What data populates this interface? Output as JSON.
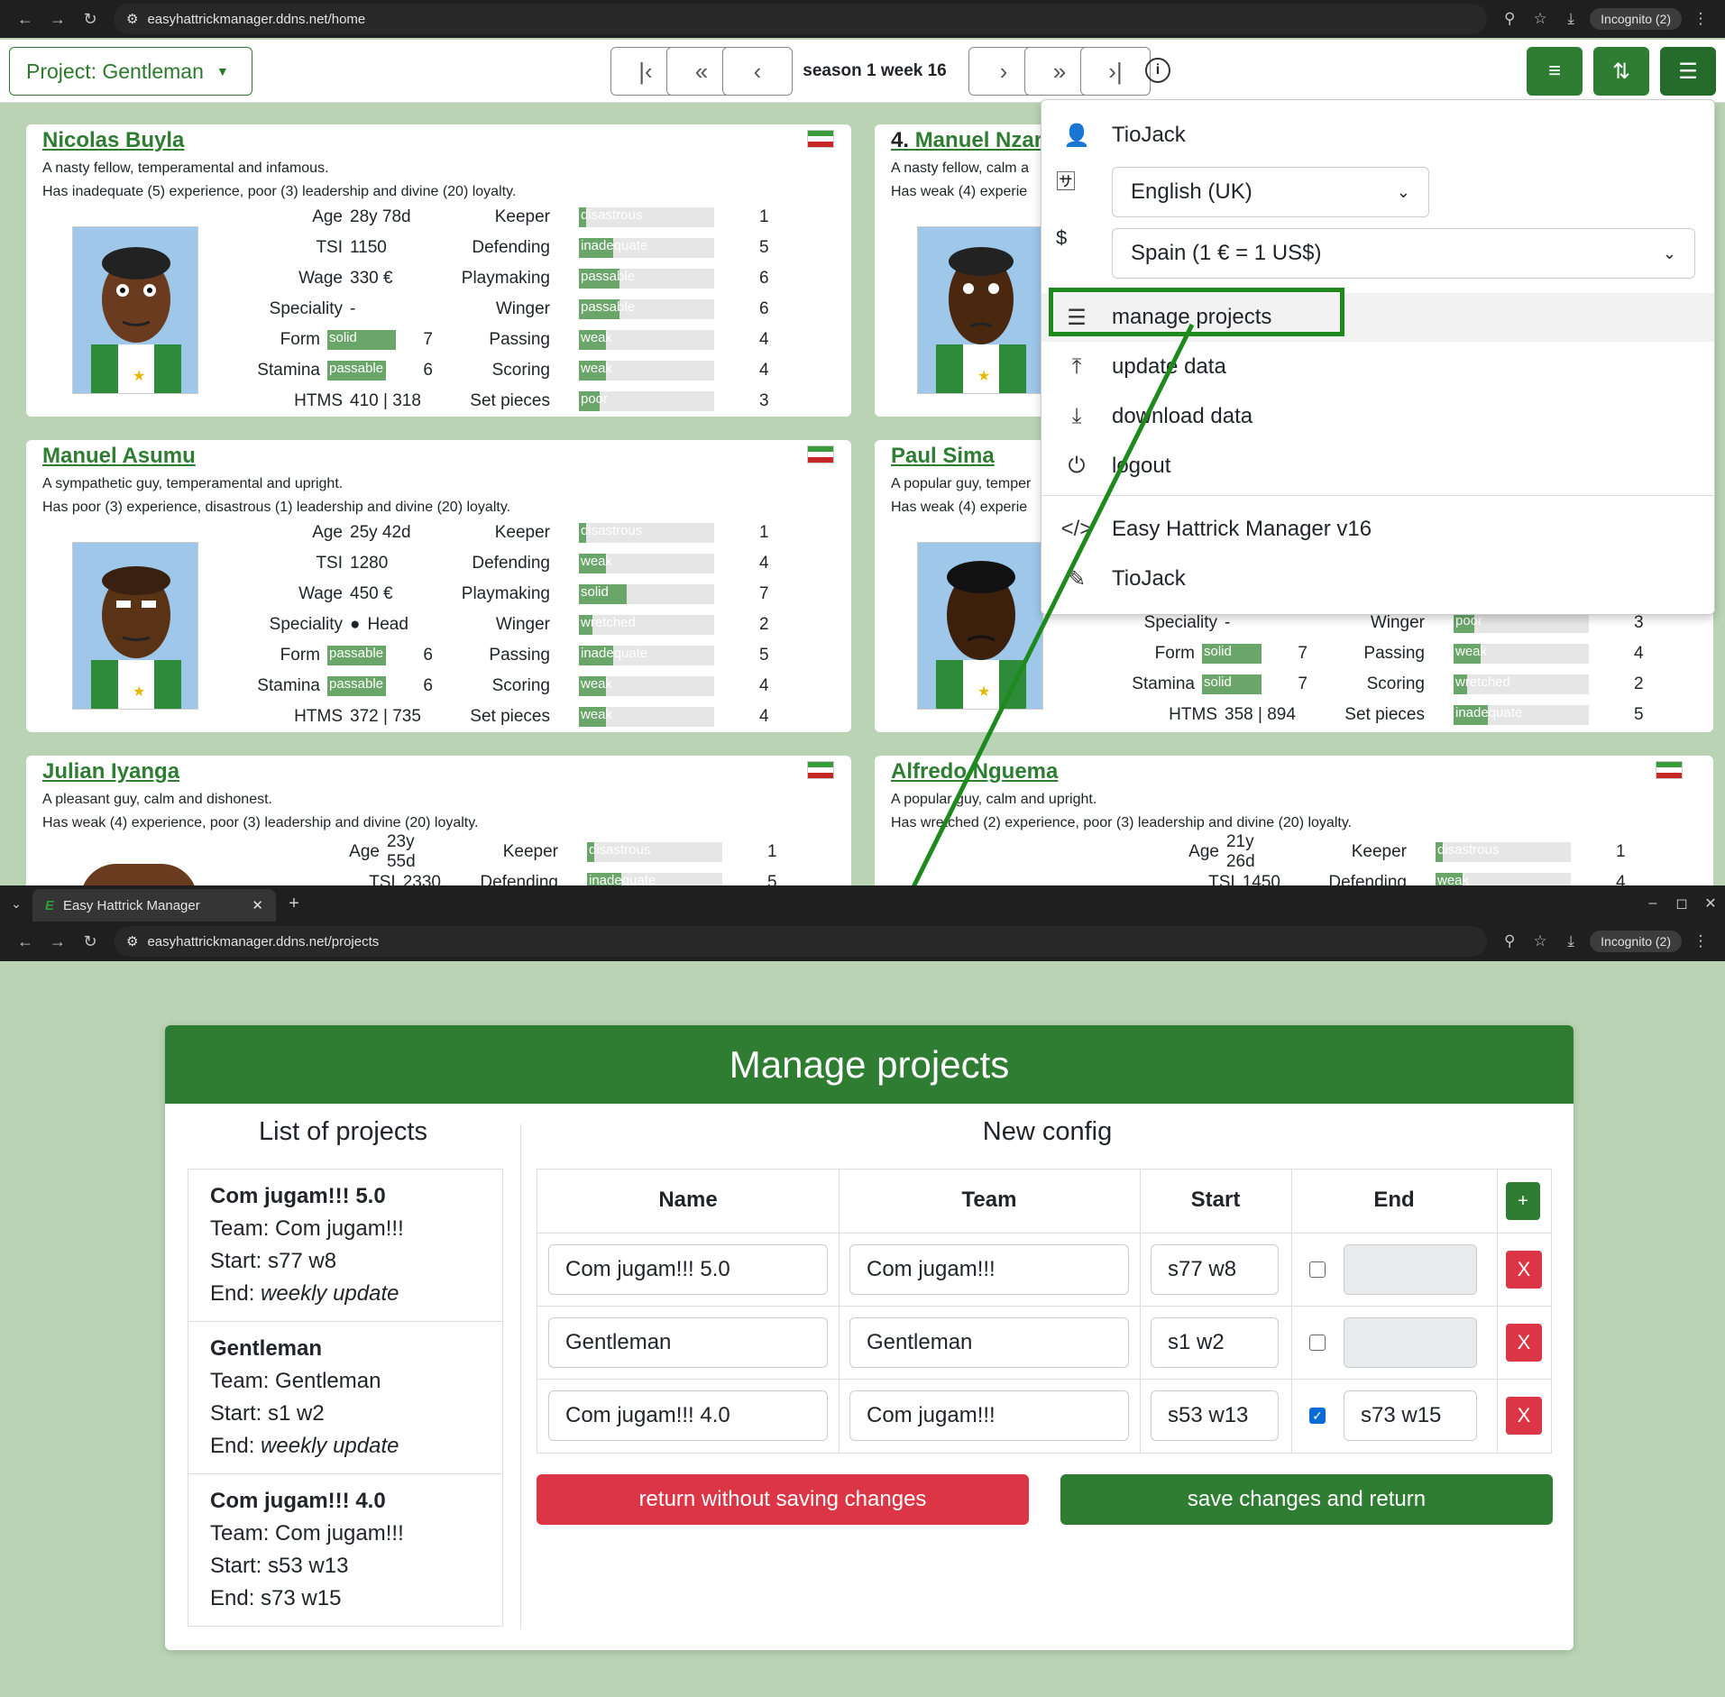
{
  "top_browser": {
    "url": "easyhattrickmanager.ddns.net/home",
    "incognito": "Incognito (2)"
  },
  "app": {
    "project_label": "Project: Gentleman",
    "season_label": "season 1 week 16",
    "players": [
      {
        "name": "Nicolas Buyla",
        "desc1": "A nasty fellow, temperamental and infamous.",
        "desc2": "Has inadequate (5) experience, poor (3) leadership and divine (20) loyalty.",
        "age": "28y 78d",
        "tsi": "1150",
        "wage": "330 €",
        "speciality": "-",
        "form": "solid",
        "form_v": "7",
        "stamina": "passable",
        "stamina_v": "6",
        "htms": "410 | 318",
        "skills": [
          [
            "Keeper",
            "disastrous",
            "1"
          ],
          [
            "Defending",
            "inadequate",
            "5"
          ],
          [
            "Playmaking",
            "passable",
            "6"
          ],
          [
            "Winger",
            "passable",
            "6"
          ],
          [
            "Passing",
            "weak",
            "4"
          ],
          [
            "Scoring",
            "weak",
            "4"
          ],
          [
            "Set pieces",
            "poor",
            "3"
          ]
        ]
      },
      {
        "name": "Manuel Asumu",
        "desc1": "A sympathetic guy, temperamental and upright.",
        "desc2": "Has poor (3) experience, disastrous (1) leadership and divine (20) loyalty.",
        "age": "25y 42d",
        "tsi": "1280",
        "wage": "450 €",
        "speciality": "Head",
        "form": "passable",
        "form_v": "6",
        "stamina": "passable",
        "stamina_v": "6",
        "htms": "372 | 735",
        "skills": [
          [
            "Keeper",
            "disastrous",
            "1"
          ],
          [
            "Defending",
            "weak",
            "4"
          ],
          [
            "Playmaking",
            "solid",
            "7"
          ],
          [
            "Winger",
            "wretched",
            "2"
          ],
          [
            "Passing",
            "inadequate",
            "5"
          ],
          [
            "Scoring",
            "weak",
            "4"
          ],
          [
            "Set pieces",
            "weak",
            "4"
          ]
        ]
      },
      {
        "name": "Julian Iyanga",
        "desc1": "A pleasant guy, calm and dishonest.",
        "desc2": "Has weak (4) experience, poor (3) leadership and divine (20) loyalty.",
        "age": "23y 55d",
        "tsi": "2330",
        "skills": [
          [
            "Keeper",
            "disastrous",
            "1"
          ],
          [
            "Defending",
            "inadequate",
            "5"
          ]
        ]
      },
      {
        "name_prefix": "4.",
        "name": "Manuel Nzar",
        "desc1": "A nasty fellow, calm a",
        "desc2": "Has weak (4) experie"
      },
      {
        "name": "Paul Sima",
        "desc1": "A popular guy, temper",
        "desc2": "Has weak (4) experie",
        "speciality": "-",
        "form": "solid",
        "form_v": "7",
        "stamina": "solid",
        "stamina_v": "7",
        "htms": "358 | 894",
        "skills": [
          [
            "Winger",
            "poor",
            "3"
          ],
          [
            "Passing",
            "weak",
            "4"
          ],
          [
            "Scoring",
            "wretched",
            "2"
          ],
          [
            "Set pieces",
            "inadequate",
            "5"
          ]
        ]
      },
      {
        "name": "Alfredo Nguema",
        "desc1": "A popular guy, calm and upright.",
        "desc2": "Has wretched (2) experience, poor (3) leadership and divine (20) loyalty.",
        "age": "21y 26d",
        "tsi": "1450",
        "skills": [
          [
            "Keeper",
            "disastrous",
            "1"
          ],
          [
            "Defending",
            "weak",
            "4"
          ]
        ]
      }
    ],
    "stat_labels": {
      "age": "Age",
      "tsi": "TSI",
      "wage": "Wage",
      "speciality": "Speciality",
      "form": "Form",
      "stamina": "Stamina",
      "htms": "HTMS"
    }
  },
  "menu": {
    "user": "TioJack",
    "language": "English (UK)",
    "currency": "Spain (1 € = 1 US$)",
    "manage": "manage projects",
    "update": "update data",
    "download": "download data",
    "logout": "logout",
    "version": "Easy Hattrick Manager v16",
    "author": "TioJack"
  },
  "bottom_browser": {
    "tab_title": "Easy Hattrick Manager",
    "url": "easyhattrickmanager.ddns.net/projects",
    "incognito": "Incognito (2)"
  },
  "projects": {
    "title": "Manage projects",
    "list_title": "List of projects",
    "config_title": "New config",
    "team_prefix": "Team: ",
    "start_prefix": "Start: ",
    "end_prefix": "End: ",
    "list": [
      {
        "name": "Com jugam!!! 5.0",
        "team": "Com jugam!!!",
        "start": "s77 w8",
        "end": "weekly update",
        "end_italic": true
      },
      {
        "name": "Gentleman",
        "team": "Gentleman",
        "start": "s1 w2",
        "end": "weekly update",
        "end_italic": true
      },
      {
        "name": "Com jugam!!! 4.0",
        "team": "Com jugam!!!",
        "start": "s53 w13",
        "end": "s73 w15",
        "end_italic": false
      }
    ],
    "columns": {
      "name": "Name",
      "team": "Team",
      "start": "Start",
      "end": "End",
      "add": "+"
    },
    "rows": [
      {
        "name": "Com jugam!!! 5.0",
        "team": "Com jugam!!!",
        "start": "s77 w8",
        "checked": false,
        "end": "",
        "del": "X"
      },
      {
        "name": "Gentleman",
        "team": "Gentleman",
        "start": "s1 w2",
        "checked": false,
        "end": "",
        "del": "X"
      },
      {
        "name": "Com jugam!!! 4.0",
        "team": "Com jugam!!!",
        "start": "s53 w13",
        "checked": true,
        "end": "s73 w15",
        "del": "X"
      }
    ],
    "cancel": "return without saving changes",
    "save": "save changes and return"
  },
  "colors": {
    "brand_green": "#2e7d32",
    "danger": "#dc3545",
    "highlight": "#1e8a1e"
  }
}
